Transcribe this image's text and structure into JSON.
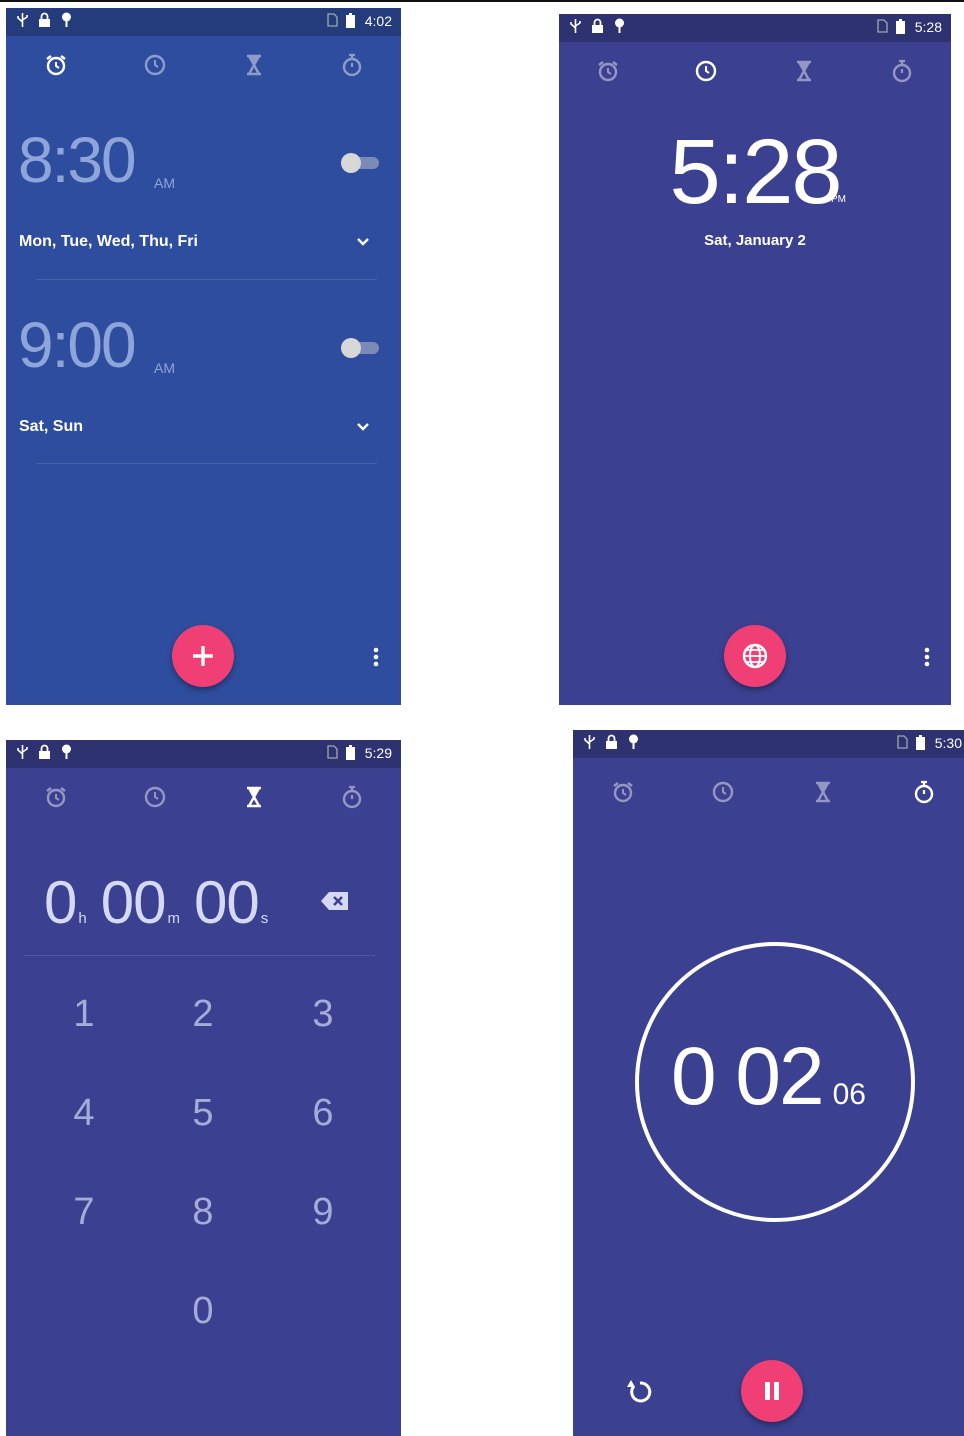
{
  "alarm_screen": {
    "status_time": "4:02",
    "tabs": [
      "alarm-icon",
      "clock-icon",
      "hourglass-icon",
      "stopwatch-icon"
    ],
    "active_tab": "alarm",
    "alarms": [
      {
        "time": "8:30",
        "ampm": "AM",
        "days": "Mon, Tue, Wed, Thu, Fri",
        "enabled": false
      },
      {
        "time": "9:00",
        "ampm": "AM",
        "days": "Sat, Sun",
        "enabled": false
      }
    ],
    "fab_icon": "plus-icon"
  },
  "clock_screen": {
    "status_time": "5:28",
    "active_tab": "clock",
    "time": "5:28",
    "ampm": "PM",
    "date": "Sat, January 2",
    "fab_icon": "globe-icon"
  },
  "timer_screen": {
    "status_time": "5:29",
    "active_tab": "timer",
    "display": {
      "hours": "0",
      "hours_unit": "h",
      "minutes": "00",
      "minutes_unit": "m",
      "seconds": "00",
      "seconds_unit": "s"
    },
    "keys": [
      "1",
      "2",
      "3",
      "4",
      "5",
      "6",
      "7",
      "8",
      "9",
      "0"
    ]
  },
  "stopwatch_screen": {
    "status_time": "5:30",
    "active_tab": "stopwatch",
    "time_main": "0 02",
    "time_hundredths": "06",
    "fab_icon": "pause-icon"
  },
  "colors": {
    "alarm_bg": "#2f4d9e",
    "indigo_bg": "#3b4190",
    "accent": "#f03f74"
  }
}
